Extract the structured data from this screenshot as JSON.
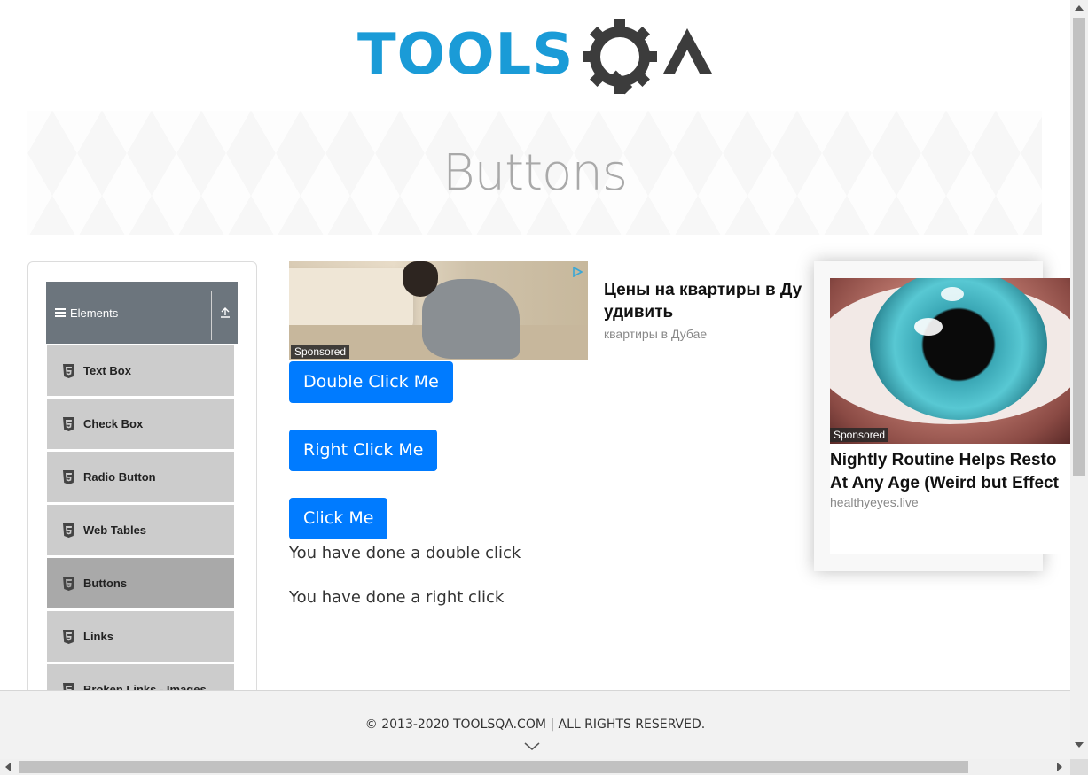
{
  "header": {
    "logo_text_primary": "TOOLS",
    "logo_text_secondary": "QA",
    "colors": {
      "logo_blue": "#1a9bd7",
      "logo_dark": "#3c3c3c"
    }
  },
  "banner": {
    "title": "Buttons"
  },
  "sidebar": {
    "group_title": "Elements",
    "items": [
      {
        "label": "Text Box",
        "active": false
      },
      {
        "label": "Check Box",
        "active": false
      },
      {
        "label": "Radio Button",
        "active": false
      },
      {
        "label": "Web Tables",
        "active": false
      },
      {
        "label": "Buttons",
        "active": true
      },
      {
        "label": "Links",
        "active": false
      },
      {
        "label": "Broken Links - Images",
        "active": false
      }
    ]
  },
  "ad_top": {
    "sponsored": "Sponsored",
    "headline_line1": "Цены на квартиры в Ду",
    "headline_line2": "удивить",
    "domain": "квартиры в Дубае"
  },
  "buttons": {
    "double_click": "Double Click Me",
    "right_click": "Right Click Me",
    "click": "Click Me",
    "color": "#007bff"
  },
  "messages": {
    "double_click": "You have done a double click",
    "right_click": "You have done a right click"
  },
  "ad_side": {
    "sponsored": "Sponsored",
    "headline_line1": "Nightly Routine Helps Resto",
    "headline_line2": "At Any Age (Weird but Effect",
    "domain": "healthyeyes.live"
  },
  "footer": {
    "copyright": "© 2013-2020 TOOLSQA.COM | ALL RIGHTS RESERVED."
  }
}
